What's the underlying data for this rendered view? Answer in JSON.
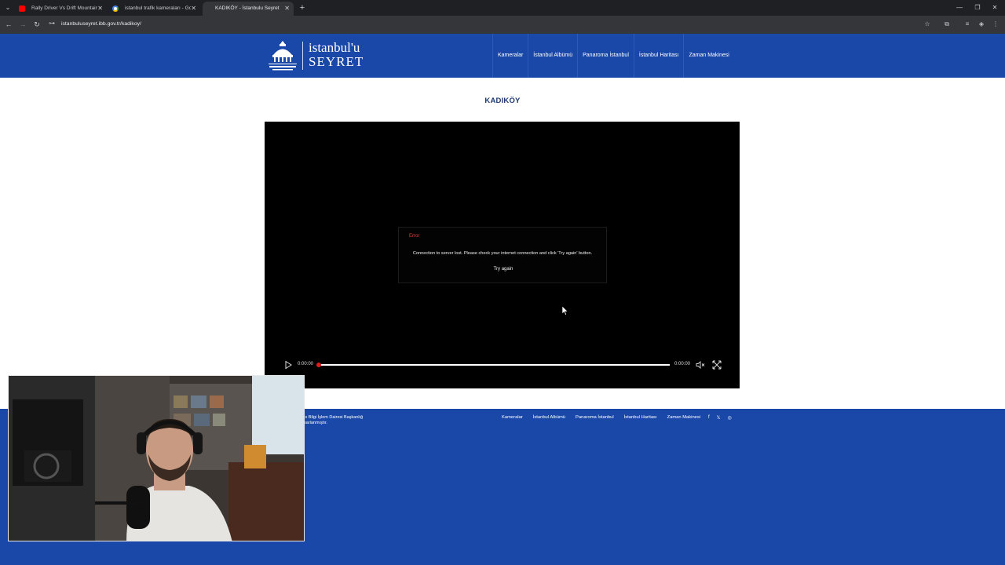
{
  "browser": {
    "tabs": [
      {
        "title": "Rally Driver Vs Drift Mountain (",
        "favicon": "youtube-icon",
        "active": false
      },
      {
        "title": "istanbul trafik kameraları - Goo",
        "favicon": "google-icon",
        "active": false
      },
      {
        "title": "KADIKÖY - İstanbulu Seyret",
        "favicon": "",
        "active": true
      }
    ],
    "url": "istanbuluseyret.ibb.gov.tr/kadikoy/"
  },
  "header": {
    "logo_brand_line1": "istanbul'u",
    "logo_brand_line2": "SEYRET",
    "logo_emblem_text": "İSTANBUL BÜYÜKŞEHİR BELEDİYESİ",
    "nav": [
      "Kameralar",
      "İstanbul Albümü",
      "Panaroma İstanbul",
      "İstanbul Haritası",
      "Zaman Makinesi"
    ]
  },
  "main": {
    "page_title": "KADIKÖY",
    "player": {
      "error_title": "Error",
      "error_message": "Connection to server lost. Please check your internet connection and click 'Try again' button.",
      "retry_label": "Try again",
      "current_time": "0:00:00",
      "duration": "0:00:00",
      "progress": 0
    }
  },
  "footer": {
    "copyright_line1": "ıs Bilgi İşlem Dairesi Başkanlığ",
    "copyright_line2": "sarlanmıştır.",
    "nav": [
      "Kameralar",
      "İstanbul Albümü",
      "Panaroma İstanbul",
      "İstanbul Haritası",
      "Zaman Makinesi"
    ],
    "social": [
      {
        "icon": "facebook-icon",
        "glyph": "f"
      },
      {
        "icon": "x-icon",
        "glyph": "𝕏"
      },
      {
        "icon": "instagram-icon",
        "glyph": "◎"
      }
    ]
  },
  "colors": {
    "brand_blue": "#1a48a8",
    "title_navy": "#1c3a72",
    "error_red": "#e0403a",
    "progress_red": "#e41b1b"
  }
}
